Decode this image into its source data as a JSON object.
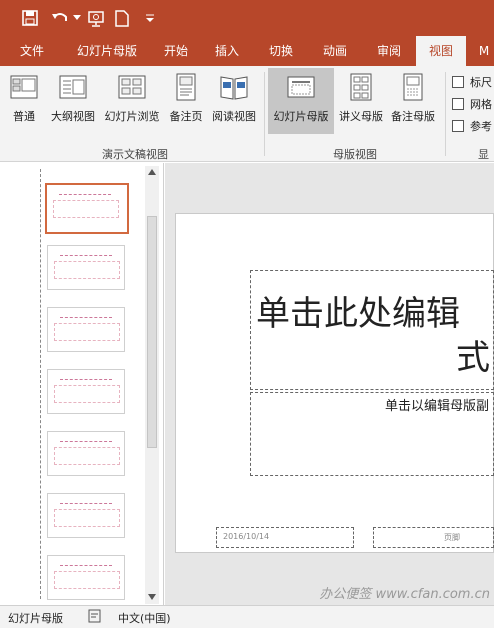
{
  "qat": {
    "save_icon": "save-icon",
    "undo_icon": "undo-icon",
    "present_icon": "present-from-start-icon",
    "new_icon": "new-file-icon",
    "customize_icon": "customize-qat-icon"
  },
  "tabs": [
    "文件",
    "幻灯片母版",
    "开始",
    "插入",
    "切换",
    "动画",
    "审阅",
    "视图",
    "M"
  ],
  "active_tab": "视图",
  "ribbon": {
    "presentation_views": {
      "label": "演示文稿视图",
      "buttons": [
        "普通",
        "大纲视图",
        "幻灯片浏览",
        "备注页",
        "阅读视图"
      ]
    },
    "master_views": {
      "label": "母版视图",
      "buttons": [
        "幻灯片母版",
        "讲义母版",
        "备注母版"
      ],
      "active": "幻灯片母版"
    },
    "show": {
      "label": "显",
      "checkboxes": [
        "标尺",
        "网格",
        "参考"
      ]
    }
  },
  "thumbnails": [
    {
      "selected": true
    },
    {
      "selected": false
    },
    {
      "selected": false
    },
    {
      "selected": false
    },
    {
      "selected": false
    },
    {
      "selected": false
    },
    {
      "selected": false
    }
  ],
  "slide": {
    "title_line1": "单击此处编辑",
    "title_line2": "式",
    "subtitle": "单击以编辑母版副",
    "footer_date": "2016/10/14",
    "footer_mid": "页脚"
  },
  "status": {
    "view_label": "幻灯片母版",
    "notes_icon": "notes-icon",
    "language": "中文(中国)"
  },
  "watermark": "办公便签 www.cfan.com.cn",
  "colors": {
    "accent": "#b7472a",
    "selected_thumb": "#d2693f"
  }
}
